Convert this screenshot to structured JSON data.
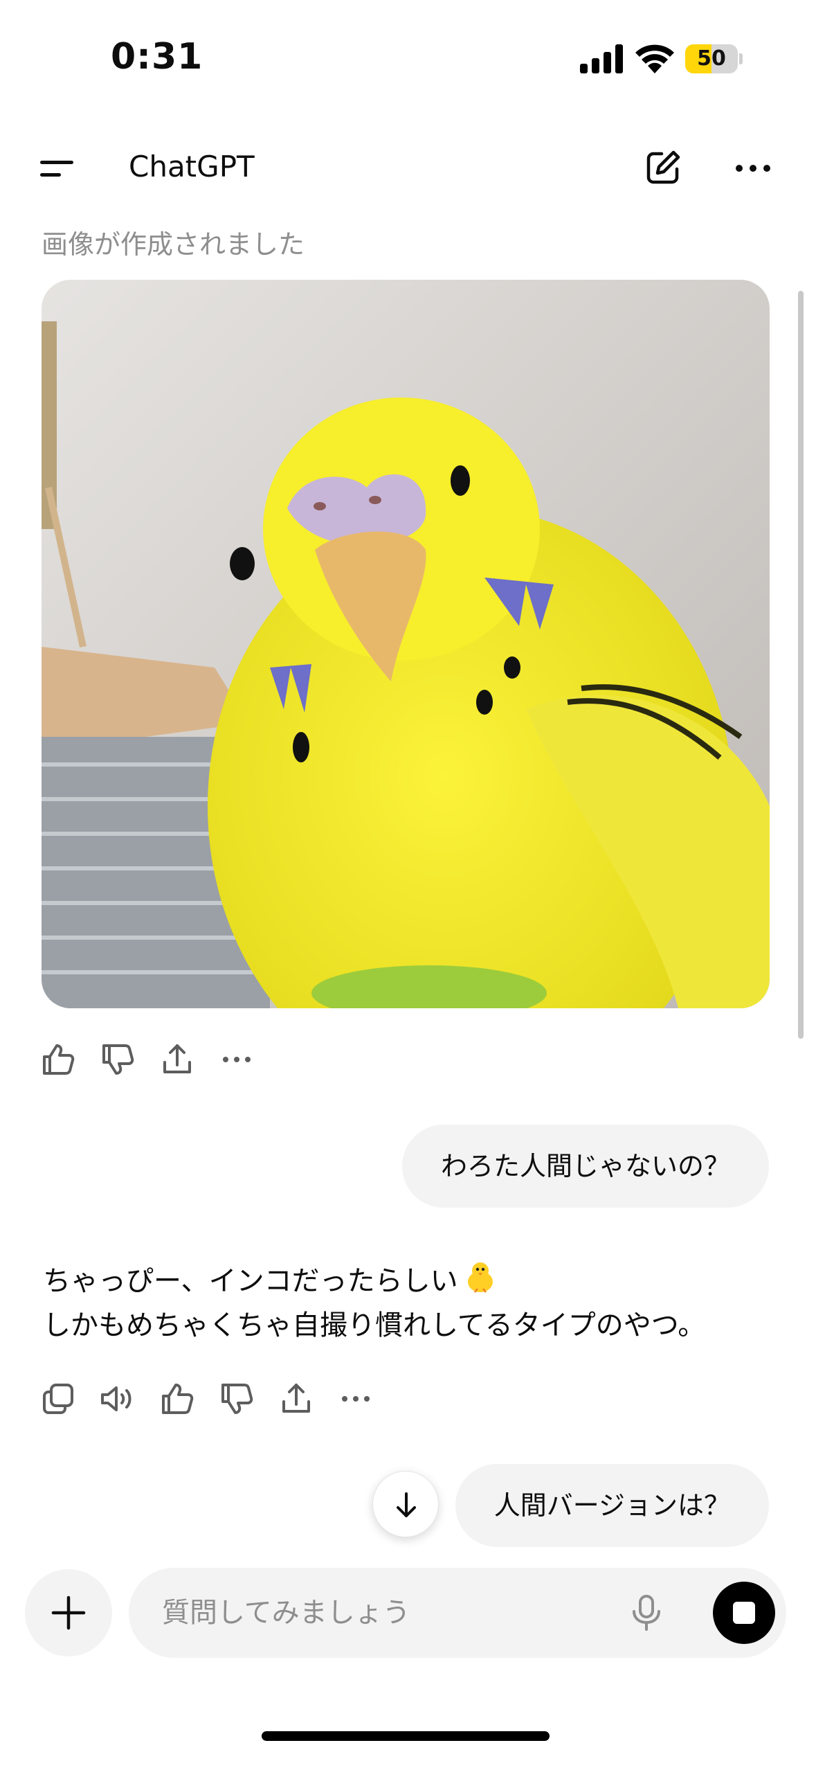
{
  "status_bar": {
    "time": "0:31",
    "battery": "50",
    "battery_level": 0.5,
    "battery_color": "#ffd60a"
  },
  "header": {
    "title": "ChatGPT"
  },
  "conversation": {
    "image_caption": "画像が作成されました",
    "user_message_1": "わろた人間じゃないの？",
    "assistant_line_1": "ちゃっぴー、インコだったらしい",
    "assistant_line_2": "しかもめちゃくちゃ自撮り慣れしてるタイプのやつ。",
    "user_message_2": "人間バージョンは？"
  },
  "composer": {
    "placeholder": "質問してみましょう"
  },
  "icons": {
    "image_actions": [
      "thumbs-up-icon",
      "thumbs-down-icon",
      "share-icon",
      "more-icon"
    ],
    "message_actions": [
      "copy-icon",
      "read-aloud-icon",
      "thumbs-up-icon",
      "thumbs-down-icon",
      "share-icon",
      "more-icon"
    ]
  }
}
